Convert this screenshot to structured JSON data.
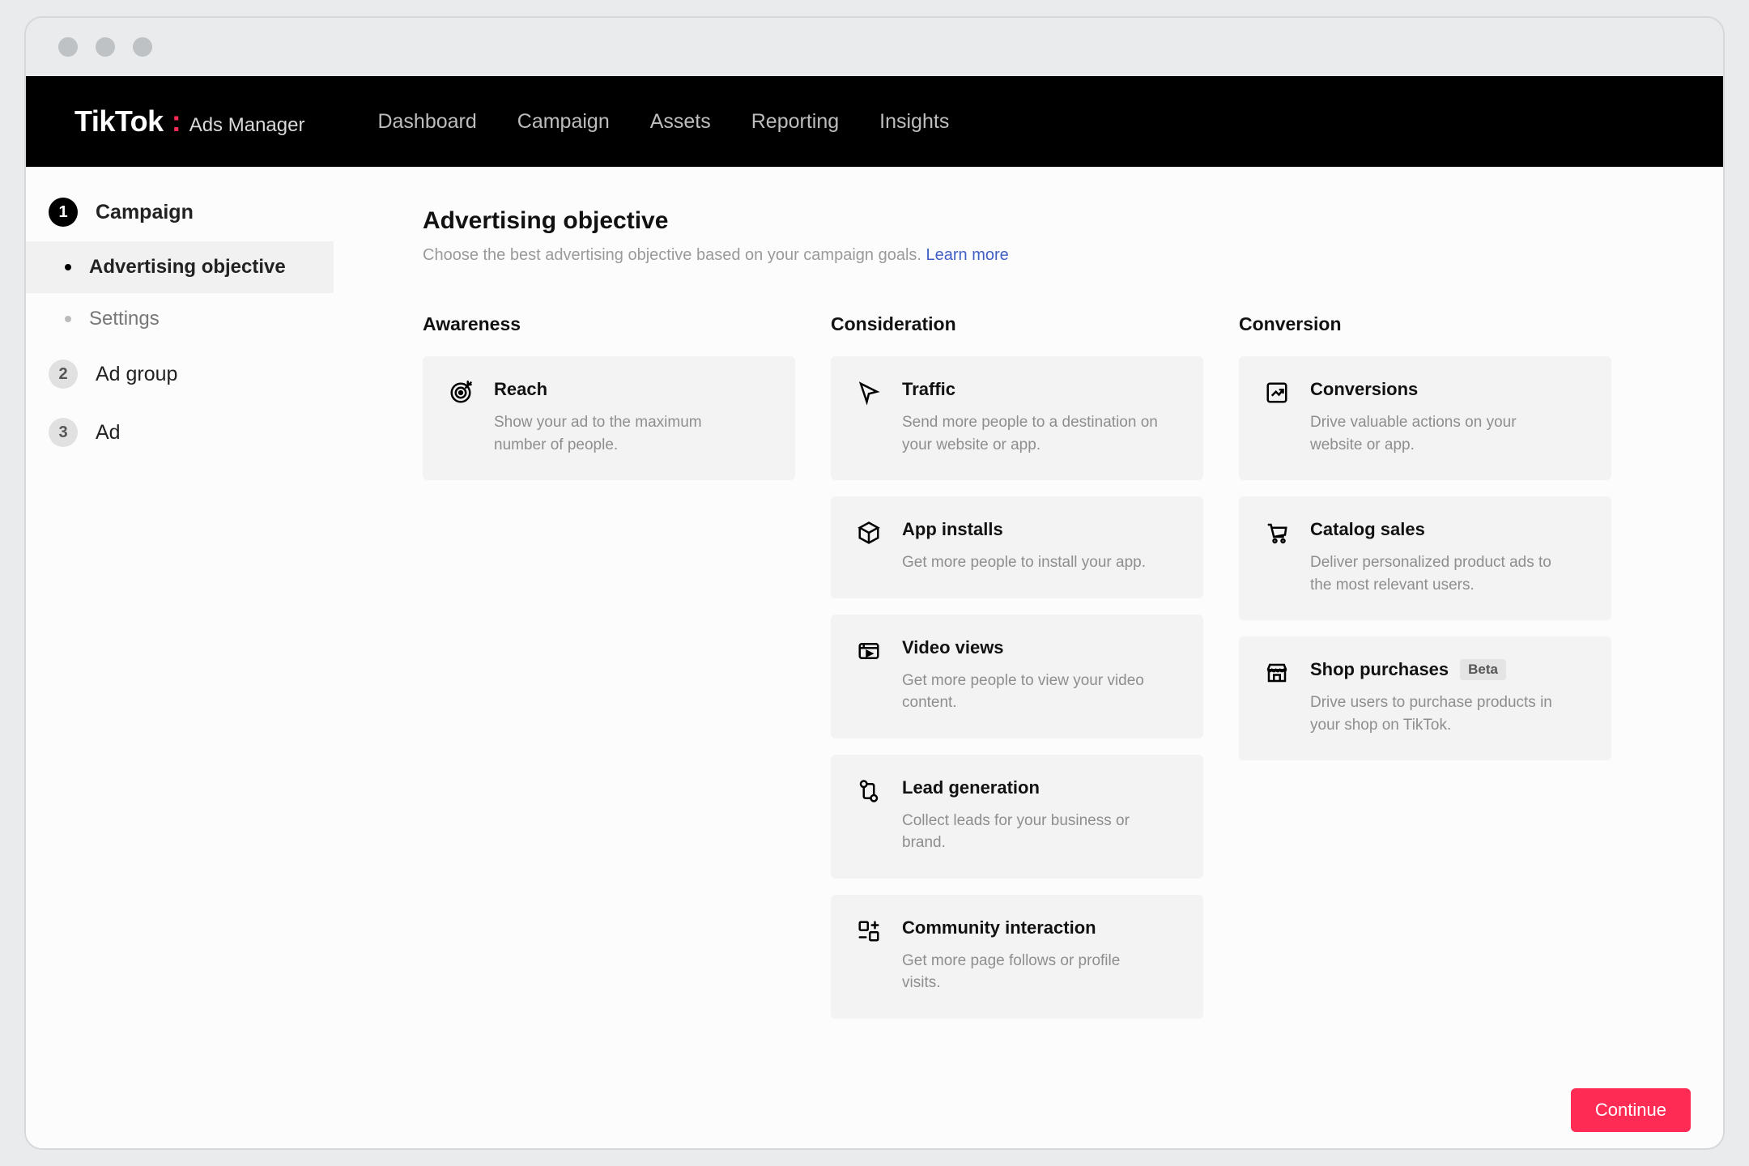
{
  "brand": {
    "name": "TikTok",
    "sub": "Ads Manager"
  },
  "topnav": [
    "Dashboard",
    "Campaign",
    "Assets",
    "Reporting",
    "Insights"
  ],
  "sidebar": {
    "steps": [
      {
        "num": "1",
        "label": "Campaign",
        "active": true,
        "sub": [
          {
            "label": "Advertising objective",
            "active": true
          },
          {
            "label": "Settings",
            "active": false
          }
        ]
      },
      {
        "num": "2",
        "label": "Ad group",
        "active": false
      },
      {
        "num": "3",
        "label": "Ad",
        "active": false
      }
    ]
  },
  "page": {
    "title": "Advertising objective",
    "sub": "Choose the best advertising objective based on your campaign goals.",
    "learn_more": "Learn more"
  },
  "columns": [
    {
      "title": "Awareness",
      "cards": [
        {
          "icon": "target-icon",
          "title": "Reach",
          "desc": "Show your ad to the maximum number of people."
        }
      ]
    },
    {
      "title": "Consideration",
      "cards": [
        {
          "icon": "cursor-icon",
          "title": "Traffic",
          "desc": "Send more people to a destination on your website or app."
        },
        {
          "icon": "cube-icon",
          "title": "App installs",
          "desc": "Get more people to install your app."
        },
        {
          "icon": "video-icon",
          "title": "Video views",
          "desc": "Get more people to view your video content."
        },
        {
          "icon": "leads-icon",
          "title": "Lead generation",
          "desc": "Collect leads for your business or brand."
        },
        {
          "icon": "community-icon",
          "title": "Community interaction",
          "desc": "Get more page follows or profile visits."
        }
      ]
    },
    {
      "title": "Conversion",
      "cards": [
        {
          "icon": "chart-up-icon",
          "title": "Conversions",
          "desc": "Drive valuable actions on your website or app."
        },
        {
          "icon": "cart-icon",
          "title": "Catalog sales",
          "desc": "Deliver personalized product ads to the most relevant users."
        },
        {
          "icon": "store-icon",
          "title": "Shop purchases",
          "badge": "Beta",
          "desc": "Drive users to purchase products in your shop on TikTok."
        }
      ]
    }
  ],
  "footer": {
    "continue": "Continue"
  }
}
